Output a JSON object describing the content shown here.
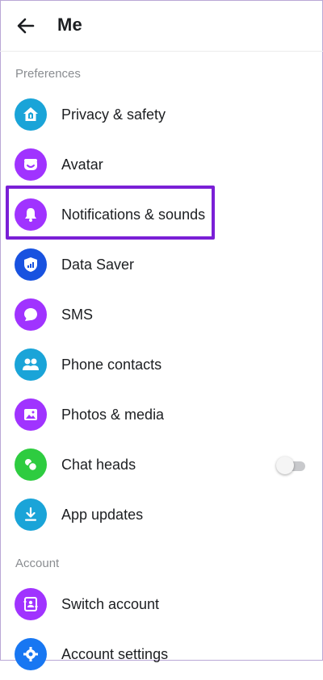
{
  "header": {
    "title": "Me",
    "back_icon": "arrow-left-icon"
  },
  "sections": {
    "preferences": "Preferences",
    "account": "Account"
  },
  "colors": {
    "teal": "#1aa4d8",
    "purple": "#a033ff",
    "blue": "#1877f2",
    "green": "#2ecc40",
    "highlight": "#7a1fd6"
  },
  "items": {
    "privacy": {
      "label": "Privacy & safety",
      "icon": "house-shield-icon"
    },
    "avatar": {
      "label": "Avatar",
      "icon": "avatar-face-icon"
    },
    "notifications": {
      "label": "Notifications & sounds",
      "icon": "bell-icon"
    },
    "data_saver": {
      "label": "Data Saver",
      "icon": "signal-shield-icon"
    },
    "sms": {
      "label": "SMS",
      "icon": "chat-bubble-icon"
    },
    "phone_contacts": {
      "label": "Phone contacts",
      "icon": "people-icon"
    },
    "photos_media": {
      "label": "Photos & media",
      "icon": "photo-icon"
    },
    "chat_heads": {
      "label": "Chat heads",
      "icon": "chat-heads-icon",
      "toggle_on": false
    },
    "app_updates": {
      "label": "App updates",
      "icon": "download-icon"
    },
    "switch_account": {
      "label": "Switch account",
      "icon": "switch-account-icon"
    },
    "account_settings": {
      "label": "Account settings",
      "icon": "gear-icon"
    }
  }
}
